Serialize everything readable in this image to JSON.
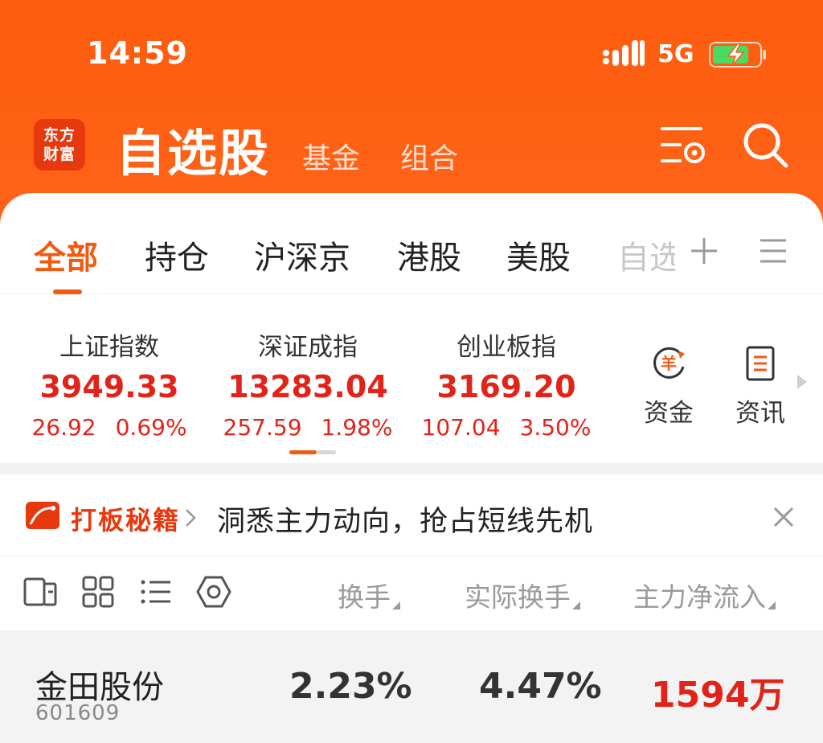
{
  "status_bar": {
    "time": "14:59",
    "network": "5G"
  },
  "header": {
    "logo_line1": "东方",
    "logo_line2": "财富",
    "title": "自选股",
    "tabs": [
      "基金",
      "组合"
    ],
    "icons": [
      "list-settings-icon",
      "search-icon"
    ]
  },
  "group_tabs": {
    "items": [
      "全部",
      "持仓",
      "沪深京",
      "港股",
      "美股",
      "自选"
    ],
    "active": "全部"
  },
  "indices": [
    {
      "name": "上证指数",
      "value": "3949.33",
      "change": "26.92",
      "pct": "0.69%"
    },
    {
      "name": "深证成指",
      "value": "13283.04",
      "change": "257.59",
      "pct": "1.98%"
    },
    {
      "name": "创业板指",
      "value": "3169.20",
      "change": "107.04",
      "pct": "3.50%"
    }
  ],
  "quick_links": {
    "fund": {
      "label": "资金",
      "icon": "yuan-flow-icon",
      "glyph": "羊"
    },
    "news": {
      "label": "资讯",
      "icon": "document-icon"
    }
  },
  "promo": {
    "brand": "打板秘籍",
    "text": "洞悉主力动向，抢占短线先机"
  },
  "table": {
    "columns": [
      "换手",
      "实际换手",
      "主力净流入"
    ],
    "rows": [
      {
        "name": "金田股份",
        "code": "601609",
        "turnover": "2.23%",
        "real_turnover": "4.47%",
        "net_inflow": "1594万"
      }
    ]
  },
  "colors": {
    "brand_orange": "#fe5c0e",
    "up_red": "#e2231a",
    "tab_active": "#f05a12"
  }
}
